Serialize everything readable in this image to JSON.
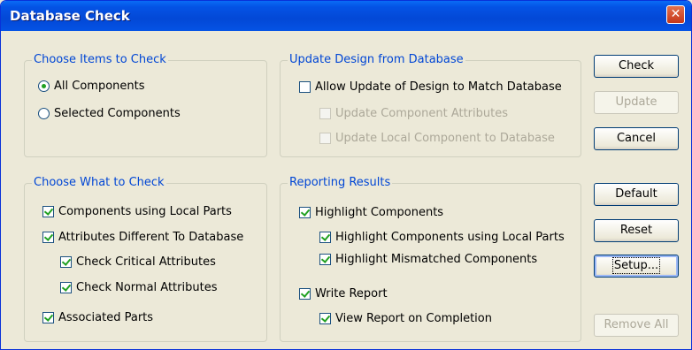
{
  "window": {
    "title": "Database Check",
    "close_glyph": "✕"
  },
  "choose_items": {
    "legend": "Choose Items to Check",
    "options": [
      {
        "label": "All Components",
        "checked": true
      },
      {
        "label": "Selected Components",
        "checked": false
      }
    ]
  },
  "update_design": {
    "legend": "Update Design from Database",
    "allow_update": {
      "label": "Allow Update of Design to Match Database",
      "checked": false
    },
    "update_attributes": {
      "label": "Update Component Attributes",
      "checked": false,
      "enabled": false
    },
    "update_local": {
      "label": "Update Local Component to Database",
      "checked": false,
      "enabled": false
    }
  },
  "choose_what": {
    "legend": "Choose What to Check",
    "items": [
      {
        "label": "Components using Local Parts",
        "checked": true
      },
      {
        "label": "Attributes Different To Database",
        "checked": true
      },
      {
        "label": "Check Critical Attributes",
        "checked": true
      },
      {
        "label": "Check Normal Attributes",
        "checked": true
      },
      {
        "label": "Associated Parts",
        "checked": true
      }
    ]
  },
  "reporting": {
    "legend": "Reporting Results",
    "items": [
      {
        "label": "Highlight Components",
        "checked": true
      },
      {
        "label": "Highlight Components using Local Parts",
        "checked": true
      },
      {
        "label": "Highlight Mismatched Components",
        "checked": true
      },
      {
        "label": "Write Report",
        "checked": true
      },
      {
        "label": "View Report on Completion",
        "checked": true
      }
    ]
  },
  "buttons": {
    "check": "Check",
    "update": "Update",
    "cancel": "Cancel",
    "default": "Default",
    "reset": "Reset",
    "setup": "Setup...",
    "remove_all": "Remove All"
  },
  "colors": {
    "title_bar": "#0453e5",
    "legend_text": "#0046d5",
    "dialog_bg": "#ece9d8",
    "checkmark": "#21a121"
  }
}
